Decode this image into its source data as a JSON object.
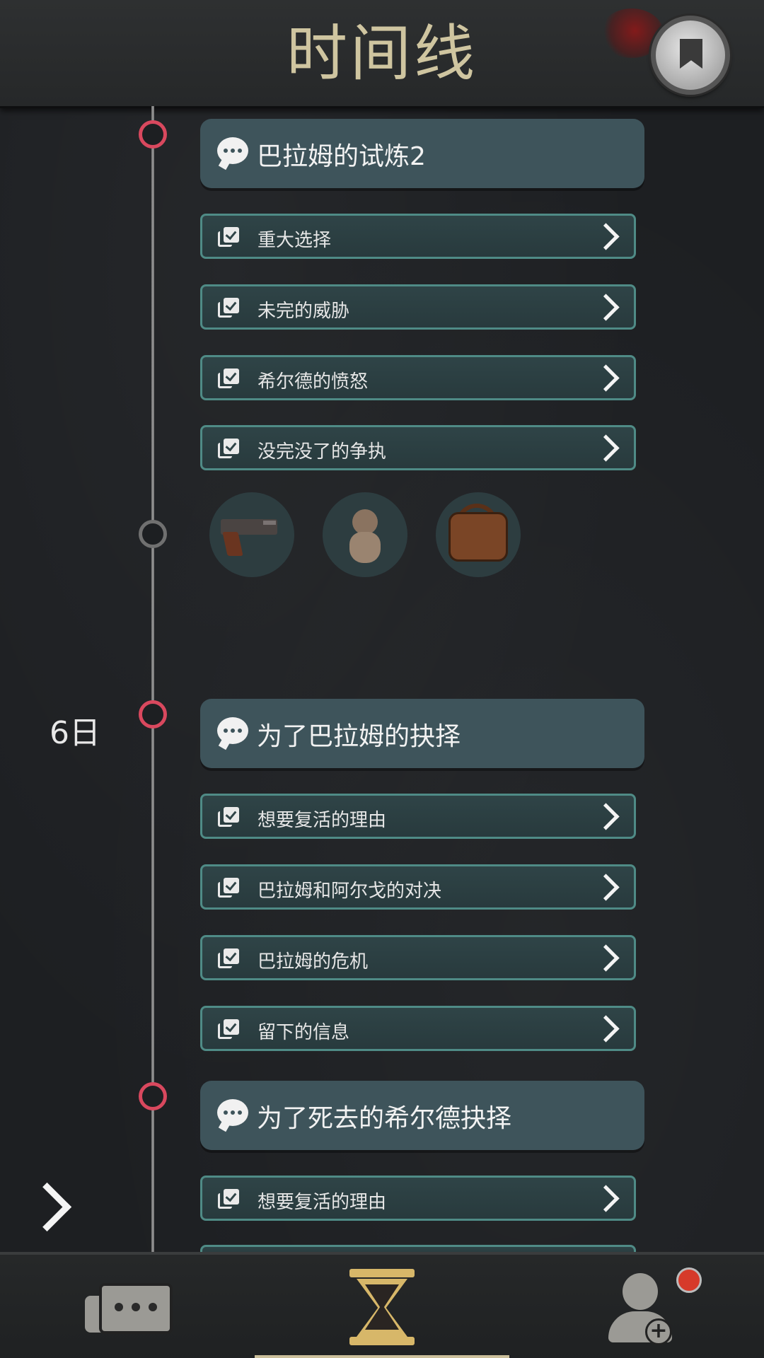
{
  "header": {
    "title": "时间线",
    "bookmark_icon": "bookmark-icon"
  },
  "timeline": {
    "day_label": "6日",
    "chapters": [
      {
        "title": "巴拉姆的试炼2",
        "events": [
          "重大选择",
          "未完的威胁",
          "希尔德的愤怒",
          "没完没了的争执"
        ],
        "items": [
          "pistol-icon",
          "doll-icon",
          "bag-icon"
        ]
      },
      {
        "title": "为了巴拉姆的抉择",
        "events": [
          "想要复活的理由",
          "巴拉姆和阿尔戈的对决",
          "巴拉姆的危机",
          "留下的信息"
        ]
      },
      {
        "title": "为了死去的希尔德抉择",
        "events": [
          "想要复活的理由"
        ]
      }
    ]
  },
  "bottom_nav": {
    "tabs": [
      "chat-icon",
      "hourglass-icon",
      "add-friend-icon"
    ],
    "active": "hourglass-icon",
    "notification": true
  },
  "colors": {
    "accent_gold": "#d7b769",
    "node_red": "#d9485e",
    "event_border": "#4f8b86",
    "chapter_bg": "#3e545b"
  }
}
